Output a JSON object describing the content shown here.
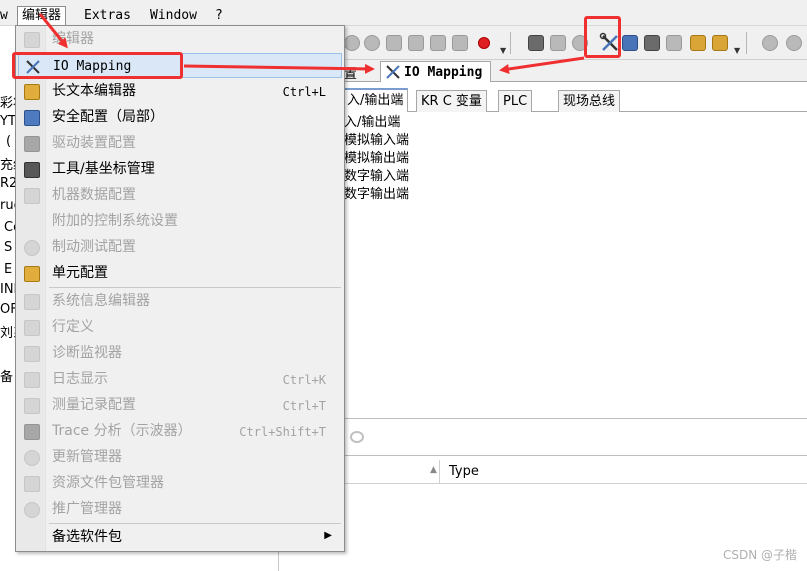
{
  "menubar": {
    "items": [
      {
        "label": "w"
      },
      {
        "label": "编辑器"
      },
      {
        "label": "Extras"
      },
      {
        "label": "Window"
      },
      {
        "label": "?"
      }
    ]
  },
  "left_panel": {
    "rows": [
      "彩状",
      "YT",
      "(",
      "充组",
      "R2",
      "ruc",
      "Co",
      "S",
      "E",
      "INI",
      "OF",
      "刘系",
      "备"
    ]
  },
  "menu": {
    "items": [
      {
        "label": "编辑器",
        "shortcut": "",
        "enabled": false,
        "icon": "editor-icon"
      },
      {
        "label": "IO Mapping",
        "shortcut": "",
        "enabled": true,
        "icon": "io-mapping-tools-icon"
      },
      {
        "label": "长文本编辑器",
        "shortcut": "Ctrl+L",
        "enabled": true,
        "icon": "long-text-editor-icon"
      },
      {
        "label": "安全配置（局部）",
        "shortcut": "",
        "enabled": true,
        "icon": "lock-icon"
      },
      {
        "label": "驱动装置配置",
        "shortcut": "",
        "enabled": false,
        "icon": "drive-config-icon"
      },
      {
        "label": "工具/基坐标管理",
        "shortcut": "",
        "enabled": true,
        "icon": "tool-base-icon"
      },
      {
        "label": "机器数据配置",
        "shortcut": "",
        "enabled": false,
        "icon": "machine-data-icon"
      },
      {
        "label": "附加的控制系统设置",
        "shortcut": "",
        "enabled": false,
        "icon": ""
      },
      {
        "label": "制动测试配置",
        "shortcut": "",
        "enabled": false,
        "icon": "brake-test-icon"
      },
      {
        "label": "单元配置",
        "shortcut": "",
        "enabled": true,
        "icon": "cell-config-icon"
      },
      {
        "label": "系统信息编辑器",
        "shortcut": "",
        "enabled": false,
        "icon": "system-info-icon"
      },
      {
        "label": "行定义",
        "shortcut": "",
        "enabled": false,
        "icon": "line-definition-icon"
      },
      {
        "label": "诊断监视器",
        "shortcut": "",
        "enabled": false,
        "icon": "diagnosis-monitor-icon"
      },
      {
        "label": "日志显示",
        "shortcut": "Ctrl+K",
        "enabled": false,
        "icon": "log-icon"
      },
      {
        "label": "测量记录配置",
        "shortcut": "Ctrl+T",
        "enabled": false,
        "icon": "measurement-icon"
      },
      {
        "label": "Trace 分析（示波器）",
        "shortcut": "Ctrl+Shift+T",
        "enabled": false,
        "icon": "oscilloscope-icon"
      },
      {
        "label": "更新管理器",
        "shortcut": "",
        "enabled": false,
        "icon": "update-manager-icon"
      },
      {
        "label": "资源文件包管理器",
        "shortcut": "",
        "enabled": false,
        "icon": "resource-package-icon"
      },
      {
        "label": "推广管理器",
        "shortcut": "",
        "enabled": false,
        "icon": "promotion-manager-icon"
      },
      {
        "label": "备选软件包",
        "shortcut": "",
        "enabled": true,
        "icon": "",
        "submenu": true
      }
    ]
  },
  "tabs": {
    "partial": "置",
    "active": "IO Mapping"
  },
  "subtabs": [
    "入/输出端",
    "KR C 变量",
    "PLC",
    "现场总线"
  ],
  "tree": [
    "入/输出端",
    "模拟输入端",
    "模拟输出端",
    "数字输入端",
    "数字输出端"
  ],
  "table": {
    "type_header": "Type"
  },
  "watermark": "CSDN @子楷",
  "colors": {
    "annotation": "#f03030",
    "highlight": "#d9e7f7",
    "accent": "#7a9cd0"
  }
}
